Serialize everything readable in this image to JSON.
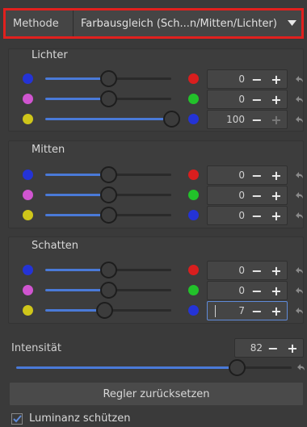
{
  "method": {
    "label": "Methode",
    "value": "Farbausgleich (Sch...n/Mitten/Lichter)",
    "dropdown_icon": "triangle-down"
  },
  "groups": [
    {
      "title": "Lichter",
      "rows": [
        {
          "left_color": "#2433d6",
          "right_color": "#d91e1e",
          "value": "0",
          "slider_fraction": 0.5,
          "plus_disabled": false
        },
        {
          "left_color": "#d055d0",
          "right_color": "#22c22a",
          "value": "0",
          "slider_fraction": 0.5,
          "plus_disabled": false
        },
        {
          "left_color": "#cfc61a",
          "right_color": "#2433d6",
          "value": "100",
          "slider_fraction": 1.0,
          "plus_disabled": true
        }
      ]
    },
    {
      "title": "Mitten",
      "rows": [
        {
          "left_color": "#2433d6",
          "right_color": "#d91e1e",
          "value": "0",
          "slider_fraction": 0.5,
          "plus_disabled": false
        },
        {
          "left_color": "#d055d0",
          "right_color": "#22c22a",
          "value": "0",
          "slider_fraction": 0.5,
          "plus_disabled": false
        },
        {
          "left_color": "#cfc61a",
          "right_color": "#2433d6",
          "value": "0",
          "slider_fraction": 0.5,
          "plus_disabled": false
        }
      ]
    },
    {
      "title": "Schatten",
      "rows": [
        {
          "left_color": "#2433d6",
          "right_color": "#d91e1e",
          "value": "0",
          "slider_fraction": 0.5,
          "plus_disabled": false
        },
        {
          "left_color": "#d055d0",
          "right_color": "#22c22a",
          "value": "0",
          "slider_fraction": 0.5,
          "plus_disabled": false
        },
        {
          "left_color": "#cfc61a",
          "right_color": "#2433d6",
          "value": "7",
          "slider_fraction": 0.465,
          "plus_disabled": false,
          "editing": true
        }
      ]
    }
  ],
  "intensity": {
    "label": "Intensität",
    "value": "82",
    "slider_fraction": 0.8
  },
  "reset_button": {
    "label": "Regler zurücksetzen"
  },
  "luminance": {
    "label": "Luminanz schützen",
    "checked": true
  },
  "icons": {
    "minus": "minus-icon",
    "plus": "plus-icon",
    "reset": "undo-arrow-icon",
    "check": "checkmark-icon"
  },
  "glyphs": {
    "minus": "−",
    "plus": "+"
  },
  "colors": {
    "accent": "#4a7ad8",
    "highlight_border": "#e0201e"
  }
}
